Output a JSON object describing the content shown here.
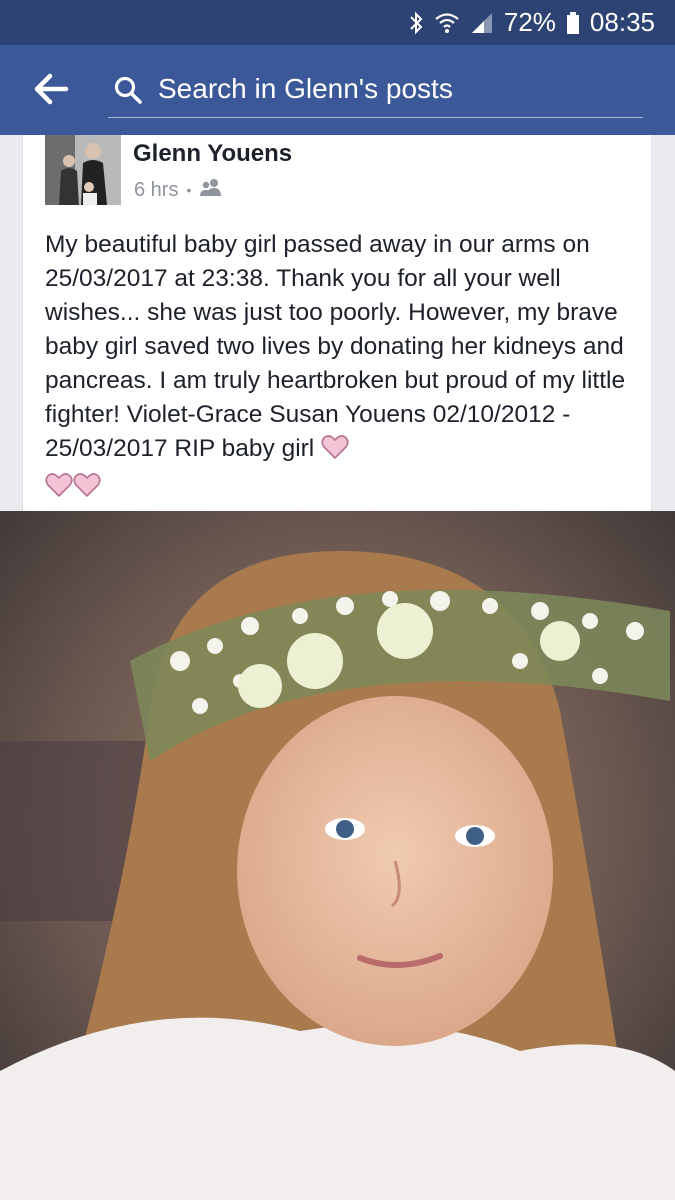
{
  "status_bar": {
    "battery_percent": "72%",
    "time": "08:35",
    "icons": [
      "bluetooth-icon",
      "wifi-icon",
      "signal-icon",
      "battery-icon"
    ]
  },
  "header": {
    "back_icon": "arrow-left-icon",
    "search_icon": "search-icon",
    "search_placeholder": "Search in Glenn's posts"
  },
  "post": {
    "author": "Glenn Youens",
    "time": "6 hrs",
    "separator": "•",
    "audience_icon": "friends-icon",
    "text": "My beautiful baby girl passed away in our arms on 25/03/2017 at 23:38. Thank you for all your well wishes... she was just too poorly. However, my brave baby girl saved two lives by donating her kidneys and pancreas. I am truly heartbroken but proud of my little fighter! Violet-Grace Susan Youens 02/10/2012 - 25/03/2017 RIP baby girl",
    "trailing_emoji": "pink-heart-icon x3"
  },
  "photo": {
    "subject": "photo"
  },
  "colors": {
    "header_bg": "#3b5998",
    "status_bg": "#2d4373",
    "heart_pink": "#f2c4d6",
    "heart_outline": "#b5718f"
  }
}
